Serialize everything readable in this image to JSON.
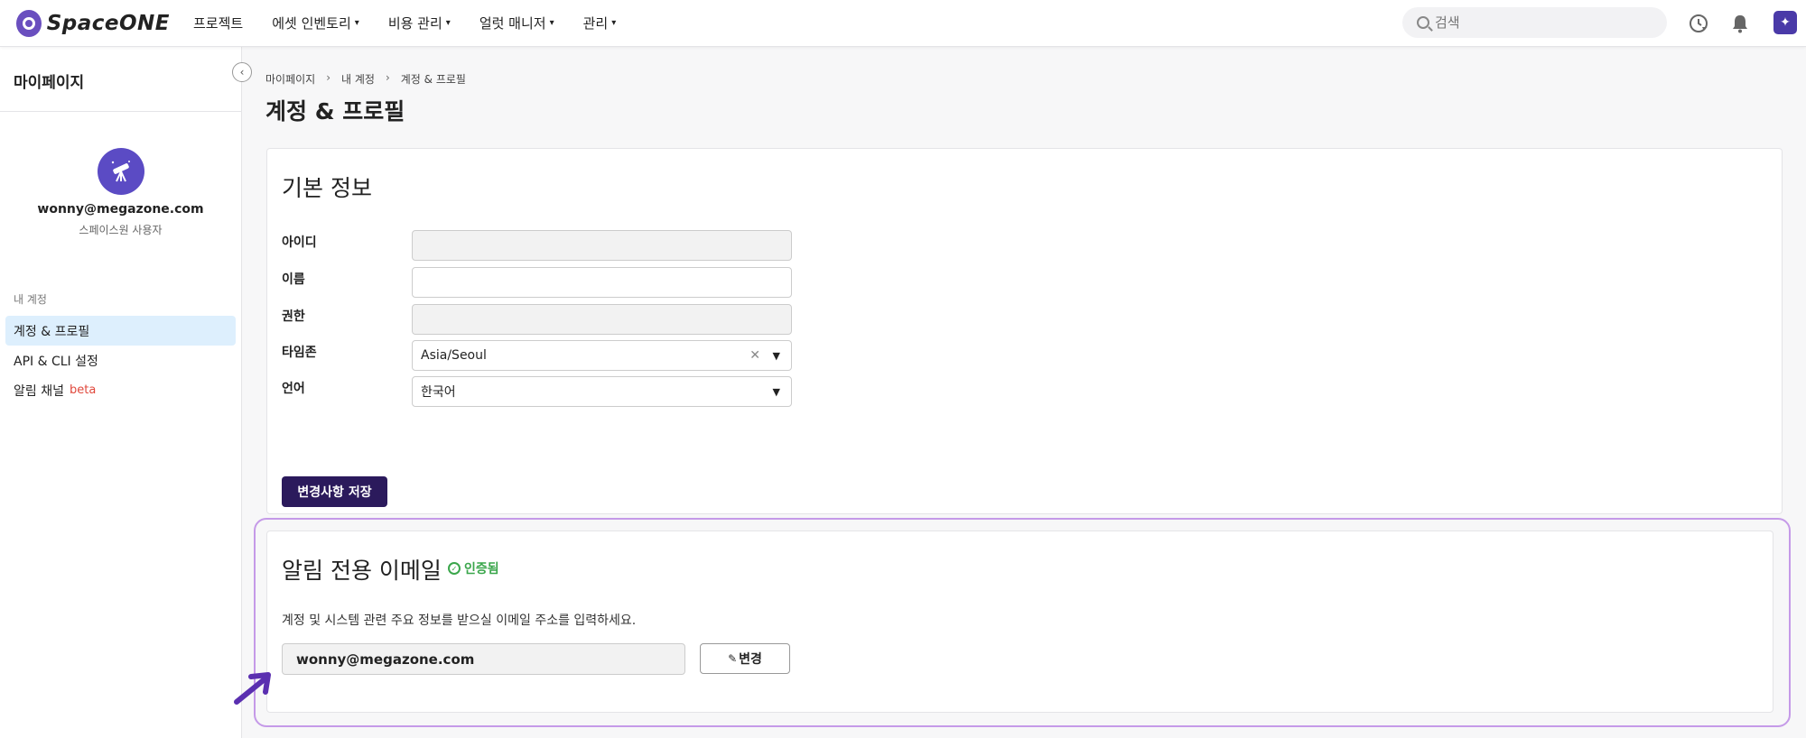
{
  "brand": {
    "name": "SpaceONE"
  },
  "topnav": {
    "menu": [
      {
        "label": "프로젝트",
        "has_caret": false
      },
      {
        "label": "에셋 인벤토리",
        "has_caret": true
      },
      {
        "label": "비용 관리",
        "has_caret": true
      },
      {
        "label": "얼럿 매니저",
        "has_caret": true
      },
      {
        "label": "관리",
        "has_caret": true
      }
    ],
    "search_placeholder": "검색",
    "icons": [
      "recent-icon",
      "bell-icon",
      "user-avatar-icon"
    ]
  },
  "sidebar": {
    "title": "마이페이지",
    "profile": {
      "email": "wonny@megazone.com",
      "role": "스페이스원 사용자"
    },
    "section_label": "내 계정",
    "items": [
      {
        "label": "계정 & 프로필",
        "active": true
      },
      {
        "label": "API & CLI 설정",
        "active": false
      },
      {
        "label": "알림 채널",
        "badge": "beta",
        "active": false
      }
    ]
  },
  "breadcrumb": [
    "마이페이지",
    "내 계정",
    "계정 & 프로필"
  ],
  "page_title": "계정 & 프로필",
  "basic_info": {
    "title": "기본 정보",
    "fields": [
      {
        "label": "아이디",
        "value": "",
        "disabled": true
      },
      {
        "label": "이름",
        "value": "",
        "disabled": false
      },
      {
        "label": "권한",
        "value": "",
        "disabled": true
      },
      {
        "label": "타임존",
        "value": "Asia/Seoul",
        "clearable": true
      },
      {
        "label": "언어",
        "value": "한국어"
      }
    ],
    "save_label": "변경사항 저장"
  },
  "notification_email": {
    "title": "알림 전용 이메일",
    "verified_label": "인증됨",
    "description": "계정 및 시스템 관련 주요 정보를 받으실 이메일 주소를 입력하세요.",
    "email": "wonny@megazone.com",
    "change_label": "변경"
  },
  "colors": {
    "brand": "#6a4fbf",
    "primary_button": "#2b1a5c",
    "active_nav": "#ddeffd",
    "verified": "#3aa64b",
    "beta": "#e0483c",
    "highlight": "#c59ae8"
  }
}
